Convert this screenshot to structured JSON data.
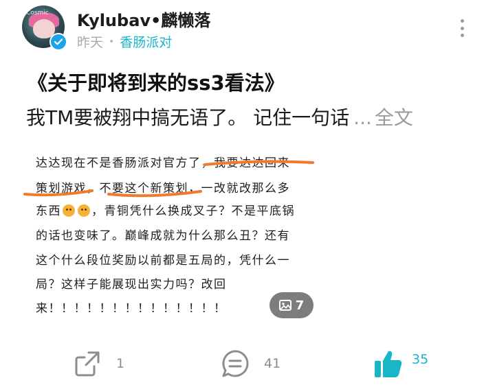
{
  "header": {
    "username": "Kylubav•麟懒落",
    "avatar_text": "Cosmic",
    "date": "昨天",
    "separator": "•",
    "circle": "香肠派对"
  },
  "post": {
    "title": "《关于即将到来的ss3看法》",
    "summary": "我TM要被翔中搞无语了。 记住一句话",
    "ellipsis": "...",
    "full_text_label": "全文"
  },
  "image_text": {
    "line1": "达达现在不是香肠派对官方了，我要达达回来",
    "line2": "策划游戏，不要这个新策划，一改就改那么多",
    "line3_a": "东西",
    "line3_b": "，青铜凭什么换成叉子？不是平底锅",
    "line4": "的话也变味了。巅峰成就为什么那么丑？还有",
    "line5": "这个什么段位奖励以前都是五局的，凭什么一",
    "line6": "局？这样子能展现出实力吗？改回",
    "line7": "来！！！！！！！！！！！！！！"
  },
  "image_badge": {
    "icon": "image-icon",
    "count": "7"
  },
  "actions": {
    "share_count": "1",
    "comment_count": "41",
    "like_count": "35"
  },
  "colors": {
    "accent": "#18b6c9",
    "verified": "#1fa3e8",
    "underline": "#f07a2a"
  }
}
